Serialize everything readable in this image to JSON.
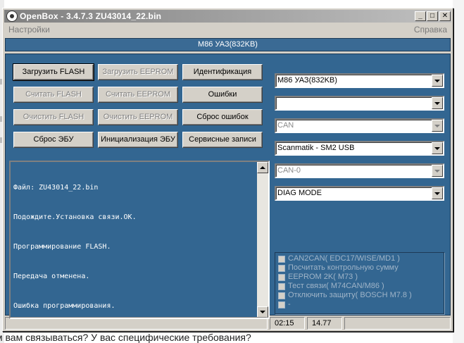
{
  "window": {
    "title": "OpenBox - 3.4.7.3 ZU43014_22.bin",
    "controls": {
      "minimize": "_",
      "maximize": "□",
      "close": "✕"
    }
  },
  "menu": {
    "settings": "Настройки",
    "help": "Справка"
  },
  "header": {
    "ecu": "M86 УАЗ(832KB)"
  },
  "buttons": {
    "load_flash": "Загрузить FLASH",
    "load_eeprom": "Загрузить EEPROM",
    "identification": "Идентификация",
    "read_flash": "Считать FLASH",
    "read_eeprom": "Считать EEPROM",
    "errors": "Ошибки",
    "clear_flash": "Очистить FLASH",
    "clear_eeprom": "Очистить EEPROM",
    "reset_errors": "Сброс ошибок",
    "reset_ecu": "Сброс ЭБУ",
    "init_ecu": "Инициализация ЭБУ",
    "service_records": "Сервисные записи"
  },
  "combos": {
    "ecu_type": "M86 УАЗ(832KB)",
    "blank": "",
    "protocol": "CAN",
    "adapter": "Scanmatik - SM2 USB",
    "channel": "CAN-0",
    "mode": "DIAG MODE"
  },
  "log": {
    "lines": [
      "Файл: ZU43014_22.bin",
      "Подождите.Установка связи.OK.",
      "Программирование FLASH.",
      "Передача отменена.",
      "Ошибка программирования."
    ]
  },
  "options": [
    "CAN2CAN( EDC17/WISE/MD1 )",
    "Посчитать контрольную сумму",
    "EEPROM 2K( M73 )",
    "Тест связи( M74CAN/M86 )",
    "Отключить защиту( BOSCH M7.8 )",
    "-"
  ],
  "status": {
    "time": "02:15",
    "value": "14.77"
  },
  "background": {
    "caption": "м вам связываться? У вас специфические требования?"
  },
  "colors": {
    "panel": "#336691",
    "header": "#3a6a94",
    "window": "#d4d0c8"
  }
}
